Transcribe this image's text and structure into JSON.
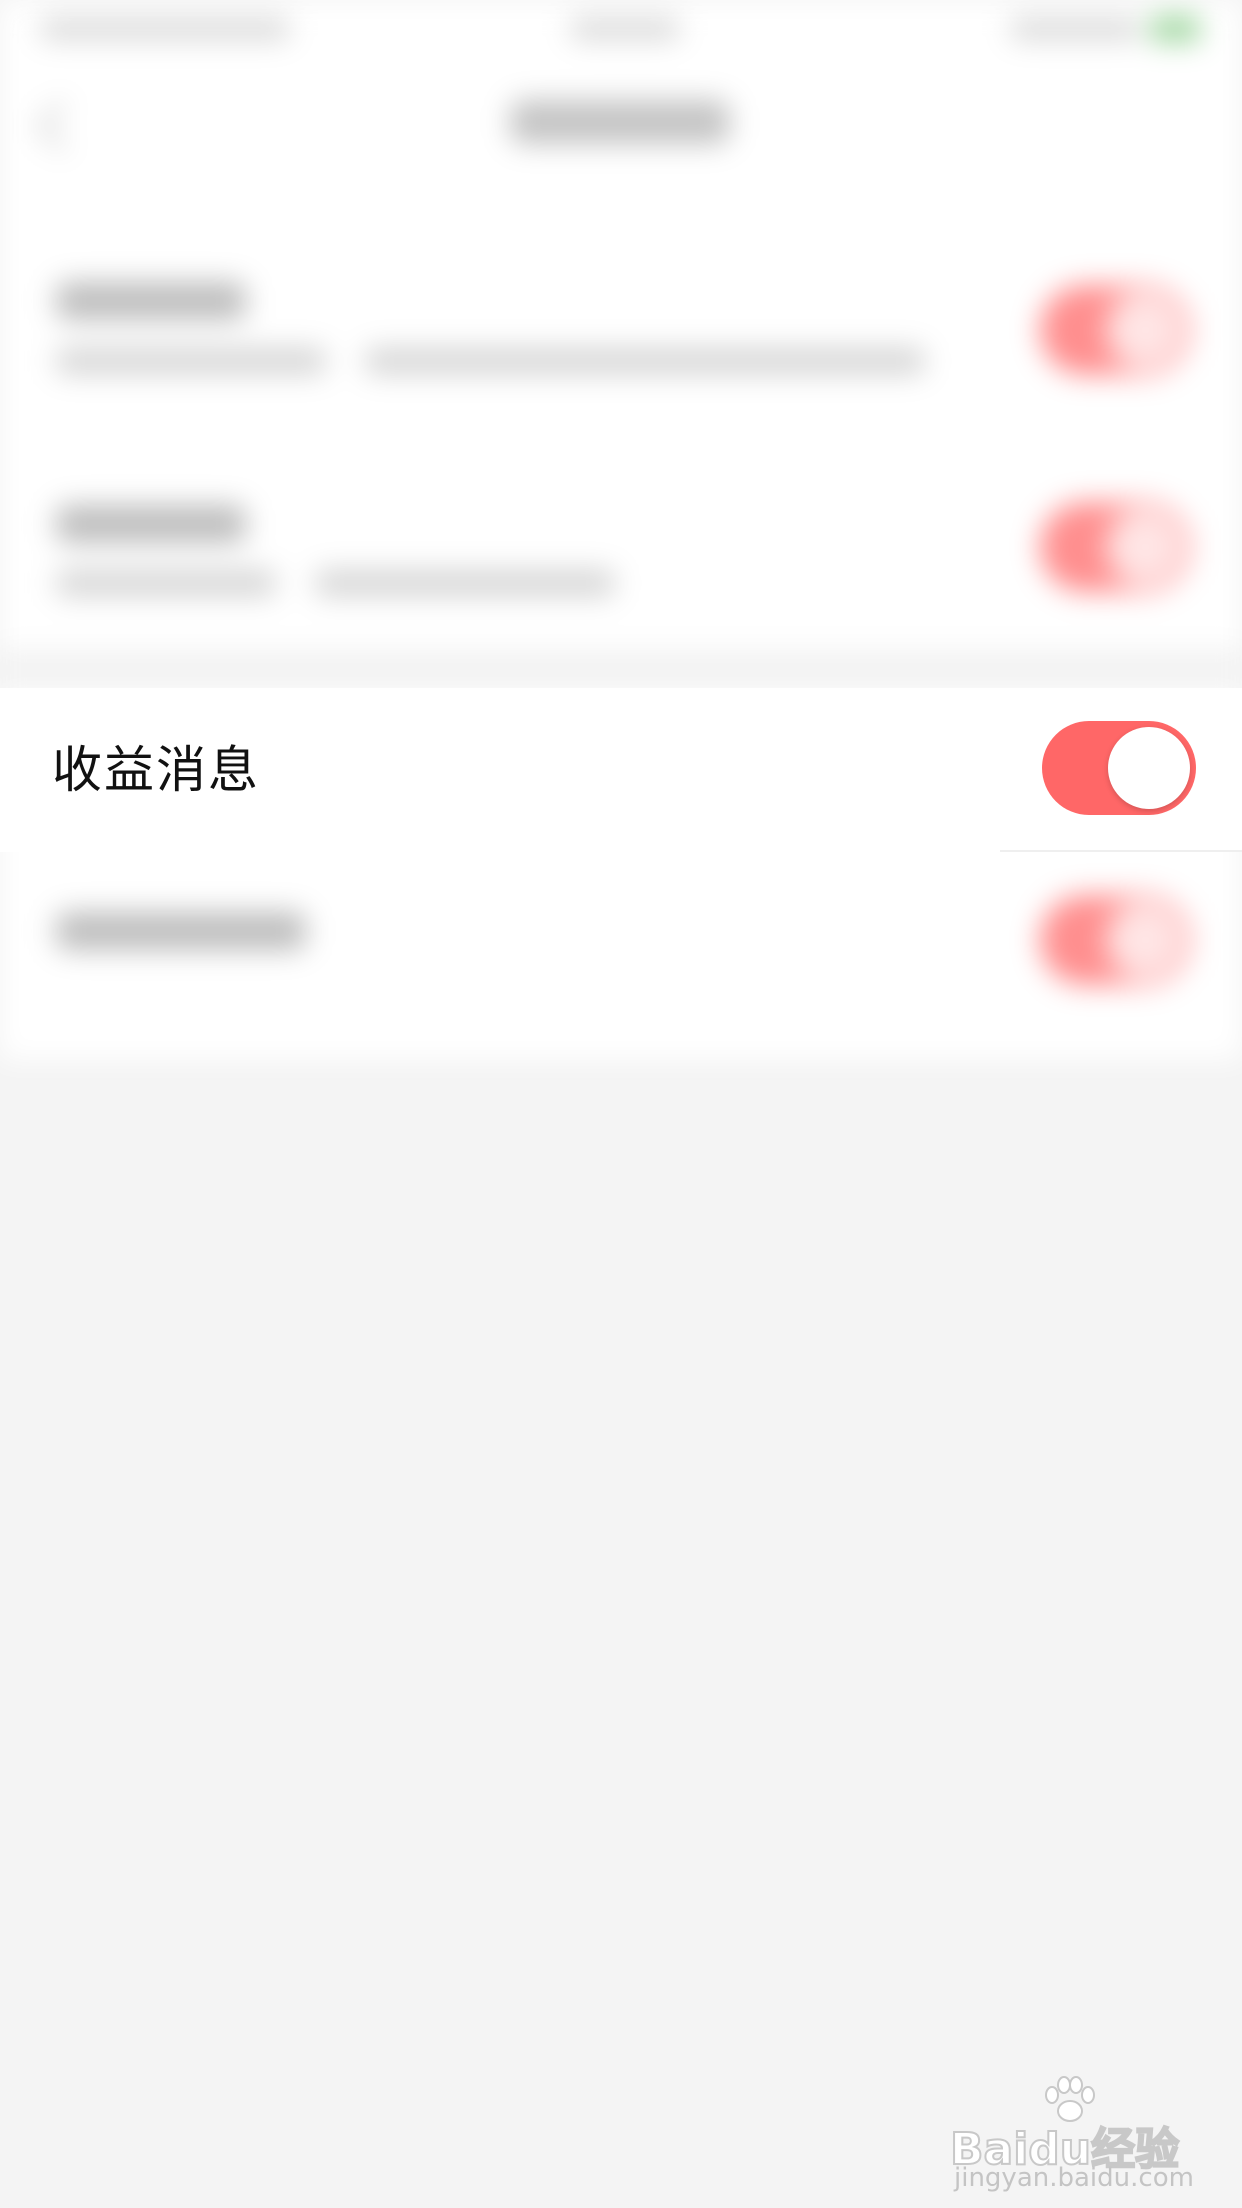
{
  "settings": {
    "earnings_message": {
      "label": "收益消息",
      "enabled": true
    }
  },
  "colors": {
    "toggle_on": "#ff6767",
    "background": "#f4f4f4"
  },
  "watermark": {
    "brand": "Baidu经验",
    "url": "jingyan.baidu.com"
  }
}
